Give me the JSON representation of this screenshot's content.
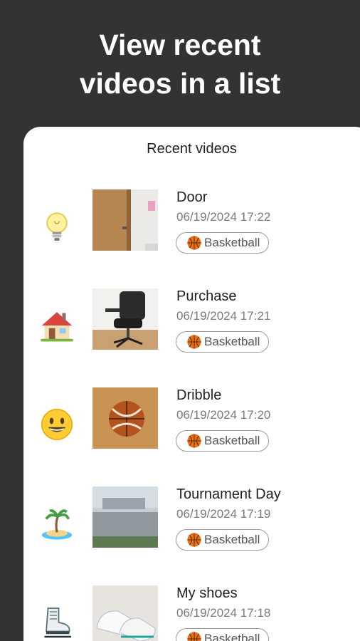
{
  "promo": {
    "headline_line1": "View recent",
    "headline_line2": "videos in a list"
  },
  "sheet": {
    "title": "Recent videos"
  },
  "videos": [
    {
      "emoji": "light-bulb",
      "thumbnail": "door-photo",
      "title": "Door",
      "date": "06/19/2024 17:22",
      "tag": "Basketball"
    },
    {
      "emoji": "house",
      "thumbnail": "office-chair-photo",
      "title": "Purchase",
      "date": "06/19/2024 17:21",
      "tag": "Basketball"
    },
    {
      "emoji": "smiling-face",
      "thumbnail": "basketball-photo",
      "title": "Dribble",
      "date": "06/19/2024 17:20",
      "tag": "Basketball"
    },
    {
      "emoji": "desert-island",
      "thumbnail": "rooftop-photo",
      "title": "Tournament Day",
      "date": "06/19/2024 17:19",
      "tag": "Basketball"
    },
    {
      "emoji": "ice-skate",
      "thumbnail": "sneakers-photo",
      "title": "My shoes",
      "date": "06/19/2024 17:18",
      "tag": "Basketball"
    }
  ],
  "colors": {
    "background": "#333333",
    "sheet": "#ffffff",
    "ball": "#E8721C",
    "chip_border": "#9a9a9a"
  }
}
